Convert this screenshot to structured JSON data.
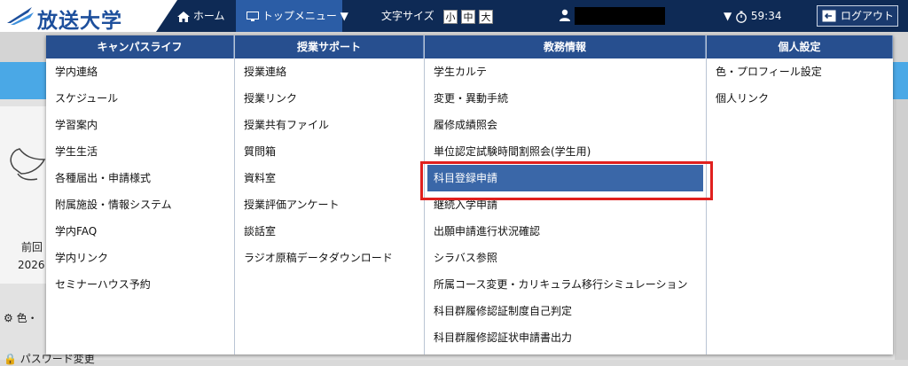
{
  "header": {
    "logo_text": "放送大学",
    "home_label": "ホーム",
    "top_menu_label": "トップメニュー",
    "font_size_label": "文字サイズ",
    "font_sizes": [
      "小",
      "中",
      "大"
    ],
    "user_name": "",
    "timer": "59:34",
    "logout_label": "ログアウト"
  },
  "background": {
    "line1": "前回",
    "line2": "2026",
    "color_label": "色・",
    "password_label": "パスワード変更"
  },
  "menu": {
    "columns": [
      {
        "title": "キャンパスライフ",
        "items": [
          "学内連絡",
          "スケジュール",
          "学習案内",
          "学生生活",
          "各種届出・申請様式",
          "附属施設・情報システム",
          "学内FAQ",
          "学内リンク",
          "セミナーハウス予約"
        ]
      },
      {
        "title": "授業サポート",
        "items": [
          "授業連絡",
          "授業リンク",
          "授業共有ファイル",
          "質問箱",
          "資料室",
          "授業評価アンケート",
          "談話室",
          "ラジオ原稿データダウンロード"
        ]
      },
      {
        "title": "教務情報",
        "items": [
          "学生カルテ",
          "変更・異動手続",
          "履修成績照会",
          "単位認定試験時間割照会(学生用)",
          "科目登録申請",
          "継続入学申請",
          "出願申請進行状況確認",
          "シラバス参照",
          "所属コース変更・カリキュラム移行シミュレーション",
          "科目群履修認証制度自己判定",
          "科目群履修認証状申請書出力"
        ]
      },
      {
        "title": "個人設定",
        "items": [
          "色・プロフィール設定",
          "個人リンク"
        ]
      }
    ],
    "selected_item": "科目登録申請"
  },
  "colors": {
    "topbar": "#0e2a55",
    "menu_header": "#274f8f",
    "selected": "#3a67a8",
    "highlight": "#e0201e"
  }
}
